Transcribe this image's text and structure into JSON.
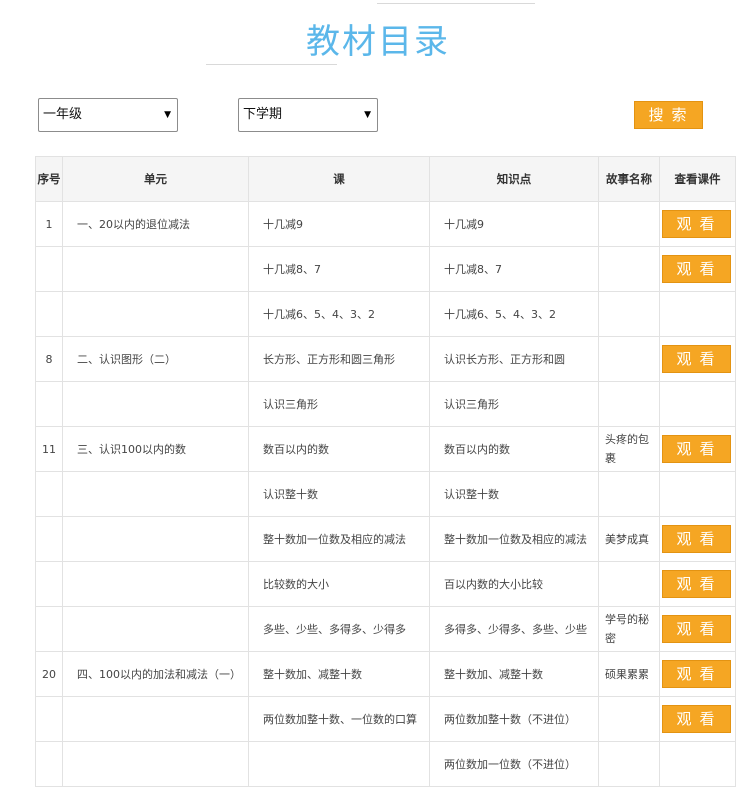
{
  "header": {
    "title": "教材目录"
  },
  "filters": {
    "grade": "一年级",
    "term": "下学期",
    "search_label": "搜索",
    "dropdown_arrow": "▼"
  },
  "table": {
    "columns": [
      "序号",
      "单元",
      "课",
      "知识点",
      "故事名称",
      "查看课件"
    ],
    "watch_label": "观看",
    "rows": [
      {
        "no": "1",
        "unit": "一、20以内的退位减法",
        "lesson": "十几减9",
        "point": "十几减9",
        "story": "",
        "watch": true
      },
      {
        "no": "",
        "unit": "",
        "lesson": "十几减8、7",
        "point": "十几减8、7",
        "story": "",
        "watch": true
      },
      {
        "no": "",
        "unit": "",
        "lesson": "十几减6、5、4、3、2",
        "point": "十几减6、5、4、3、2",
        "story": "",
        "watch": false
      },
      {
        "no": "8",
        "unit": "二、认识图形（二）",
        "lesson": "长方形、正方形和圆三角形",
        "point": "认识长方形、正方形和圆",
        "story": "",
        "watch": true
      },
      {
        "no": "",
        "unit": "",
        "lesson": "认识三角形",
        "point": "认识三角形",
        "story": "",
        "watch": false
      },
      {
        "no": "11",
        "unit": "三、认识100以内的数",
        "lesson": "数百以内的数",
        "point": "数百以内的数",
        "story": "头疼的包裹",
        "watch": true
      },
      {
        "no": "",
        "unit": "",
        "lesson": "认识整十数",
        "point": "认识整十数",
        "story": "",
        "watch": false
      },
      {
        "no": "",
        "unit": "",
        "lesson": "整十数加一位数及相应的减法",
        "point": "整十数加一位数及相应的减法",
        "story": "美梦成真",
        "watch": true
      },
      {
        "no": "",
        "unit": "",
        "lesson": "比较数的大小",
        "point": "百以内数的大小比较",
        "story": "",
        "watch": true
      },
      {
        "no": "",
        "unit": "",
        "lesson": "多些、少些、多得多、少得多",
        "point": "多得多、少得多、多些、少些",
        "story": "学号的秘密",
        "watch": true
      },
      {
        "no": "20",
        "unit": "四、100以内的加法和减法（一）",
        "lesson": "整十数加、减整十数",
        "point": "整十数加、减整十数",
        "story": "硕果累累",
        "watch": true
      },
      {
        "no": "",
        "unit": "",
        "lesson": "两位数加整十数、一位数的口算",
        "point": "两位数加整十数（不进位）",
        "story": "",
        "watch": true
      },
      {
        "no": "",
        "unit": "",
        "lesson": "",
        "point": "两位数加一位数（不进位）",
        "story": "",
        "watch": false
      }
    ]
  }
}
